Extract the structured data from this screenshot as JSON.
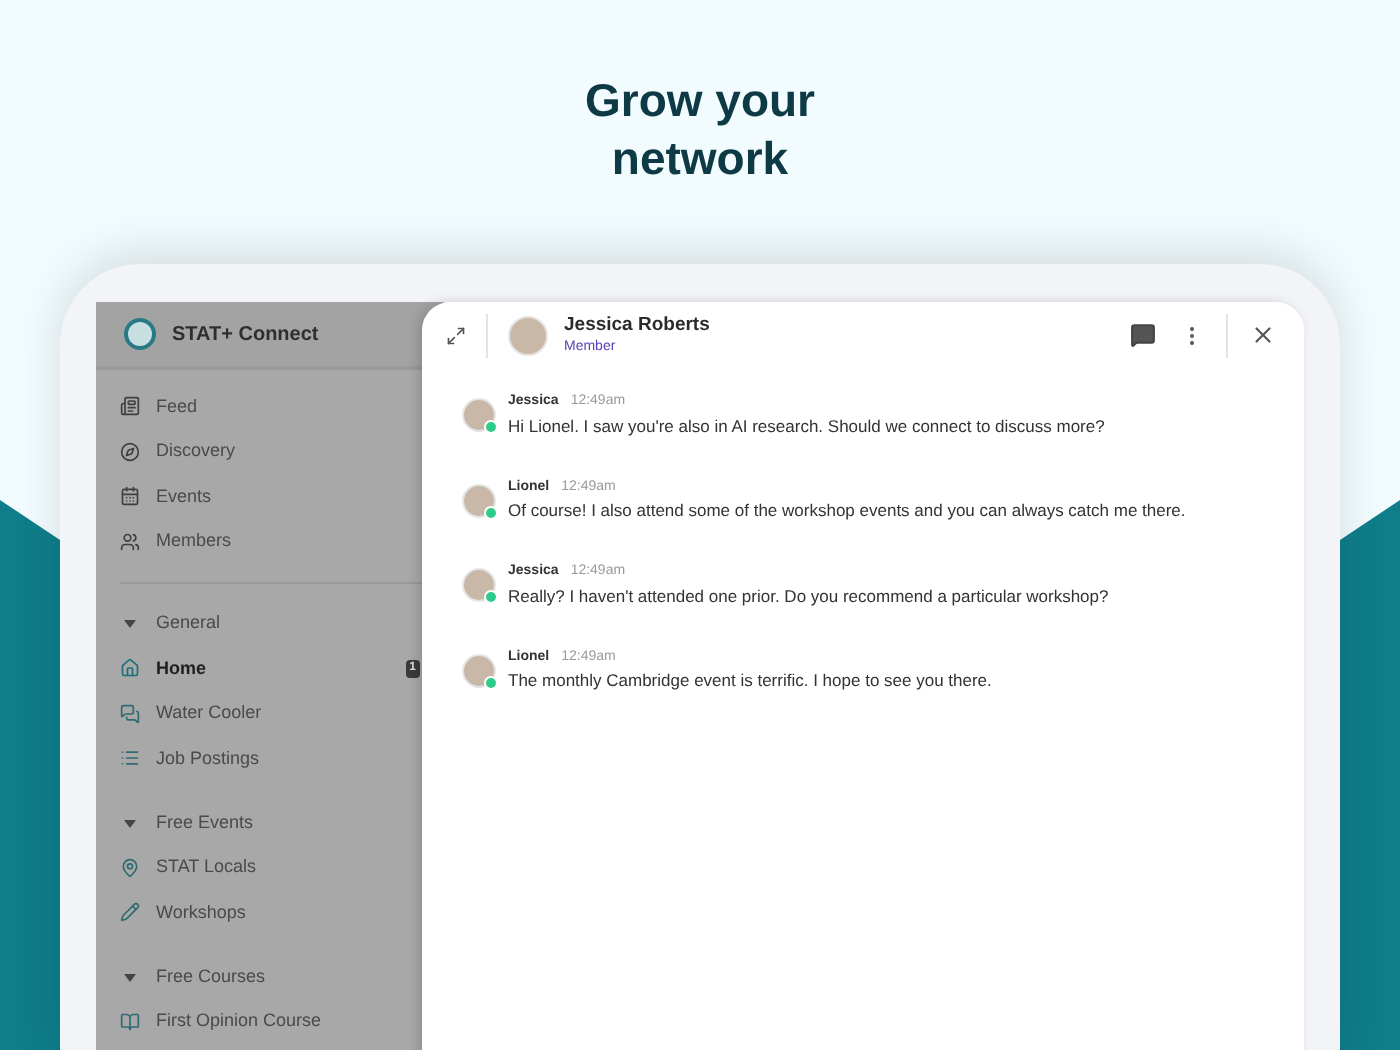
{
  "headline": "Grow your network",
  "sidebar": {
    "app_name": "STAT+ Connect",
    "nav": [
      {
        "label": "Feed",
        "selected": false
      },
      {
        "label": "Discovery",
        "selected": false
      },
      {
        "label": "Events",
        "selected": false
      },
      {
        "label": "Members",
        "selected": false
      }
    ],
    "sections": [
      {
        "label": "General",
        "expanded": true,
        "items": [
          {
            "label": "Home",
            "selected": true,
            "badge": "1"
          },
          {
            "label": "Water Cooler",
            "selected": false
          },
          {
            "label": "Job Postings",
            "selected": false
          }
        ]
      },
      {
        "label": "Free Events",
        "expanded": true,
        "items": [
          {
            "label": "STAT Locals",
            "selected": false
          },
          {
            "label": "Workshops",
            "selected": false
          }
        ]
      },
      {
        "label": "Free Courses",
        "expanded": true,
        "items": [
          {
            "label": "First Opinion Course",
            "selected": false
          }
        ]
      }
    ]
  },
  "chat": {
    "contact": {
      "name": "Jessica Roberts",
      "role": "Member"
    },
    "messages": [
      {
        "author": "Jessica",
        "time": "12:49am",
        "text": "Hi Lionel. I saw you're also in AI research. Should we connect to discuss more?",
        "online": true
      },
      {
        "author": "Lionel",
        "time": "12:49am",
        "text": "Of course! I also attend some of the workshop events and you can always catch me there.",
        "online": true
      },
      {
        "author": "Jessica",
        "time": "12:49am",
        "text": "Really? I haven't attended one prior. Do you recommend a particular workshop?",
        "online": true
      },
      {
        "author": "Lionel",
        "time": "12:49am",
        "text": "The monthly Cambridge event is terrific. I hope to see you there.",
        "online": true
      }
    ]
  }
}
